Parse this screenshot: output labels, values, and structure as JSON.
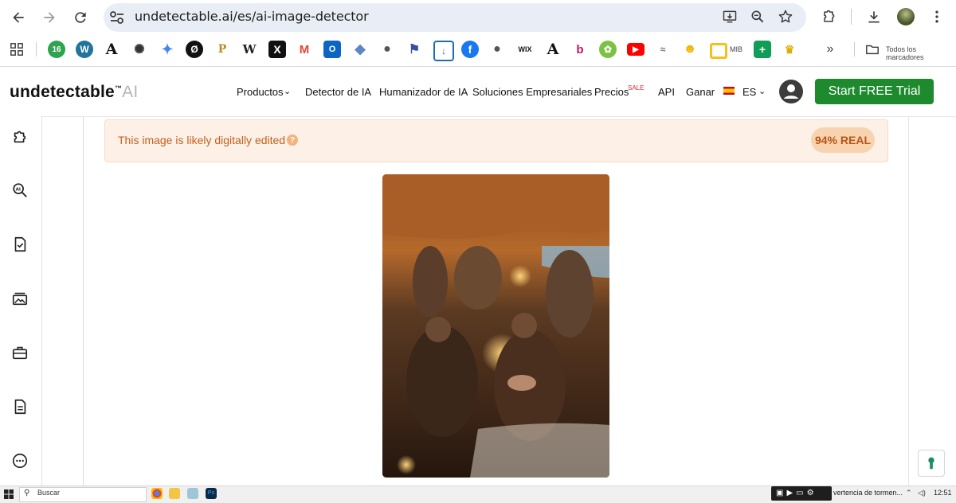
{
  "browser": {
    "url": "undetectable.ai/es/ai-image-detector",
    "bookmarks": {
      "badge_count": "16",
      "wix": "WIX",
      "mib": "MIB",
      "all_bookmarks": "Todos los marcadores"
    }
  },
  "site": {
    "logo_main": "undetectable",
    "logo_tm": "™",
    "logo_ai": "AI",
    "nav": {
      "productos": "Productos",
      "detector": "Detector de IA",
      "humanizador": "Humanizador de IA",
      "soluciones": "Soluciones Empresariales",
      "precios": "Precios",
      "sale": "SALE",
      "api": "API",
      "ganar": "Ganar",
      "lang": "ES"
    },
    "cta": "Start FREE Trial"
  },
  "result": {
    "message": "This image is likely digitally edited",
    "help": "?",
    "score": "94% REAL"
  },
  "taskbar": {
    "search": "Buscar",
    "notification": "vertencia de tormen...",
    "time": "12:51"
  },
  "colors": {
    "cta_green": "#1d8a2e",
    "banner_bg": "#fdf1e7",
    "banner_text": "#c4601c",
    "pill_bg": "#f7d3b0"
  }
}
